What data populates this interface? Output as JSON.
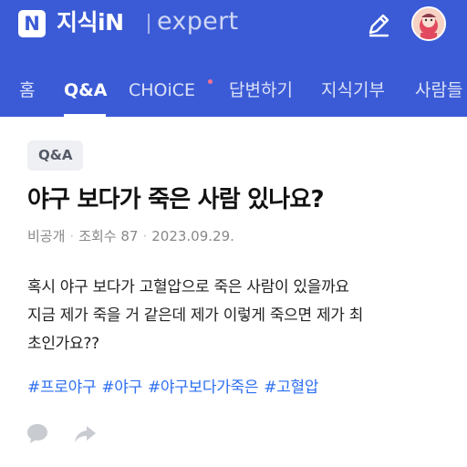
{
  "header": {
    "logo_letter": "N",
    "brand_name": "지식iN",
    "brand_sub": "expert",
    "edit_icon": "pencil-icon",
    "profile_icon": "avatar-icon"
  },
  "nav": {
    "items": [
      {
        "label": "홈"
      },
      {
        "label": "Q&A"
      },
      {
        "label": "CHOiCE"
      },
      {
        "label": "답변하기"
      },
      {
        "label": "지식기부"
      },
      {
        "label": "사람들"
      }
    ],
    "active_index": 1
  },
  "post": {
    "category_tag": "Q&A",
    "title": "야구 보다가 죽은 사람 있나요?",
    "author": "비공개",
    "views_label": "조회수 87",
    "date": "2023.09.29.",
    "body": "혹시 야구 보다가 고혈압으로 죽은 사람이 있을까요\n지금 제가 죽을 거 같은데 제가 이렇게 죽으면 제가 최\n초인가요??",
    "hashtags": [
      "#프로야구",
      "#야구",
      "#야구보다가죽은",
      "#고혈압"
    ]
  },
  "actions": {
    "comment_icon": "comment-icon",
    "share_icon": "share-icon"
  },
  "colors": {
    "header_bg": "#3b5bd6",
    "hashtag": "#2e6ff0",
    "new_dot": "#ff6f8f"
  }
}
